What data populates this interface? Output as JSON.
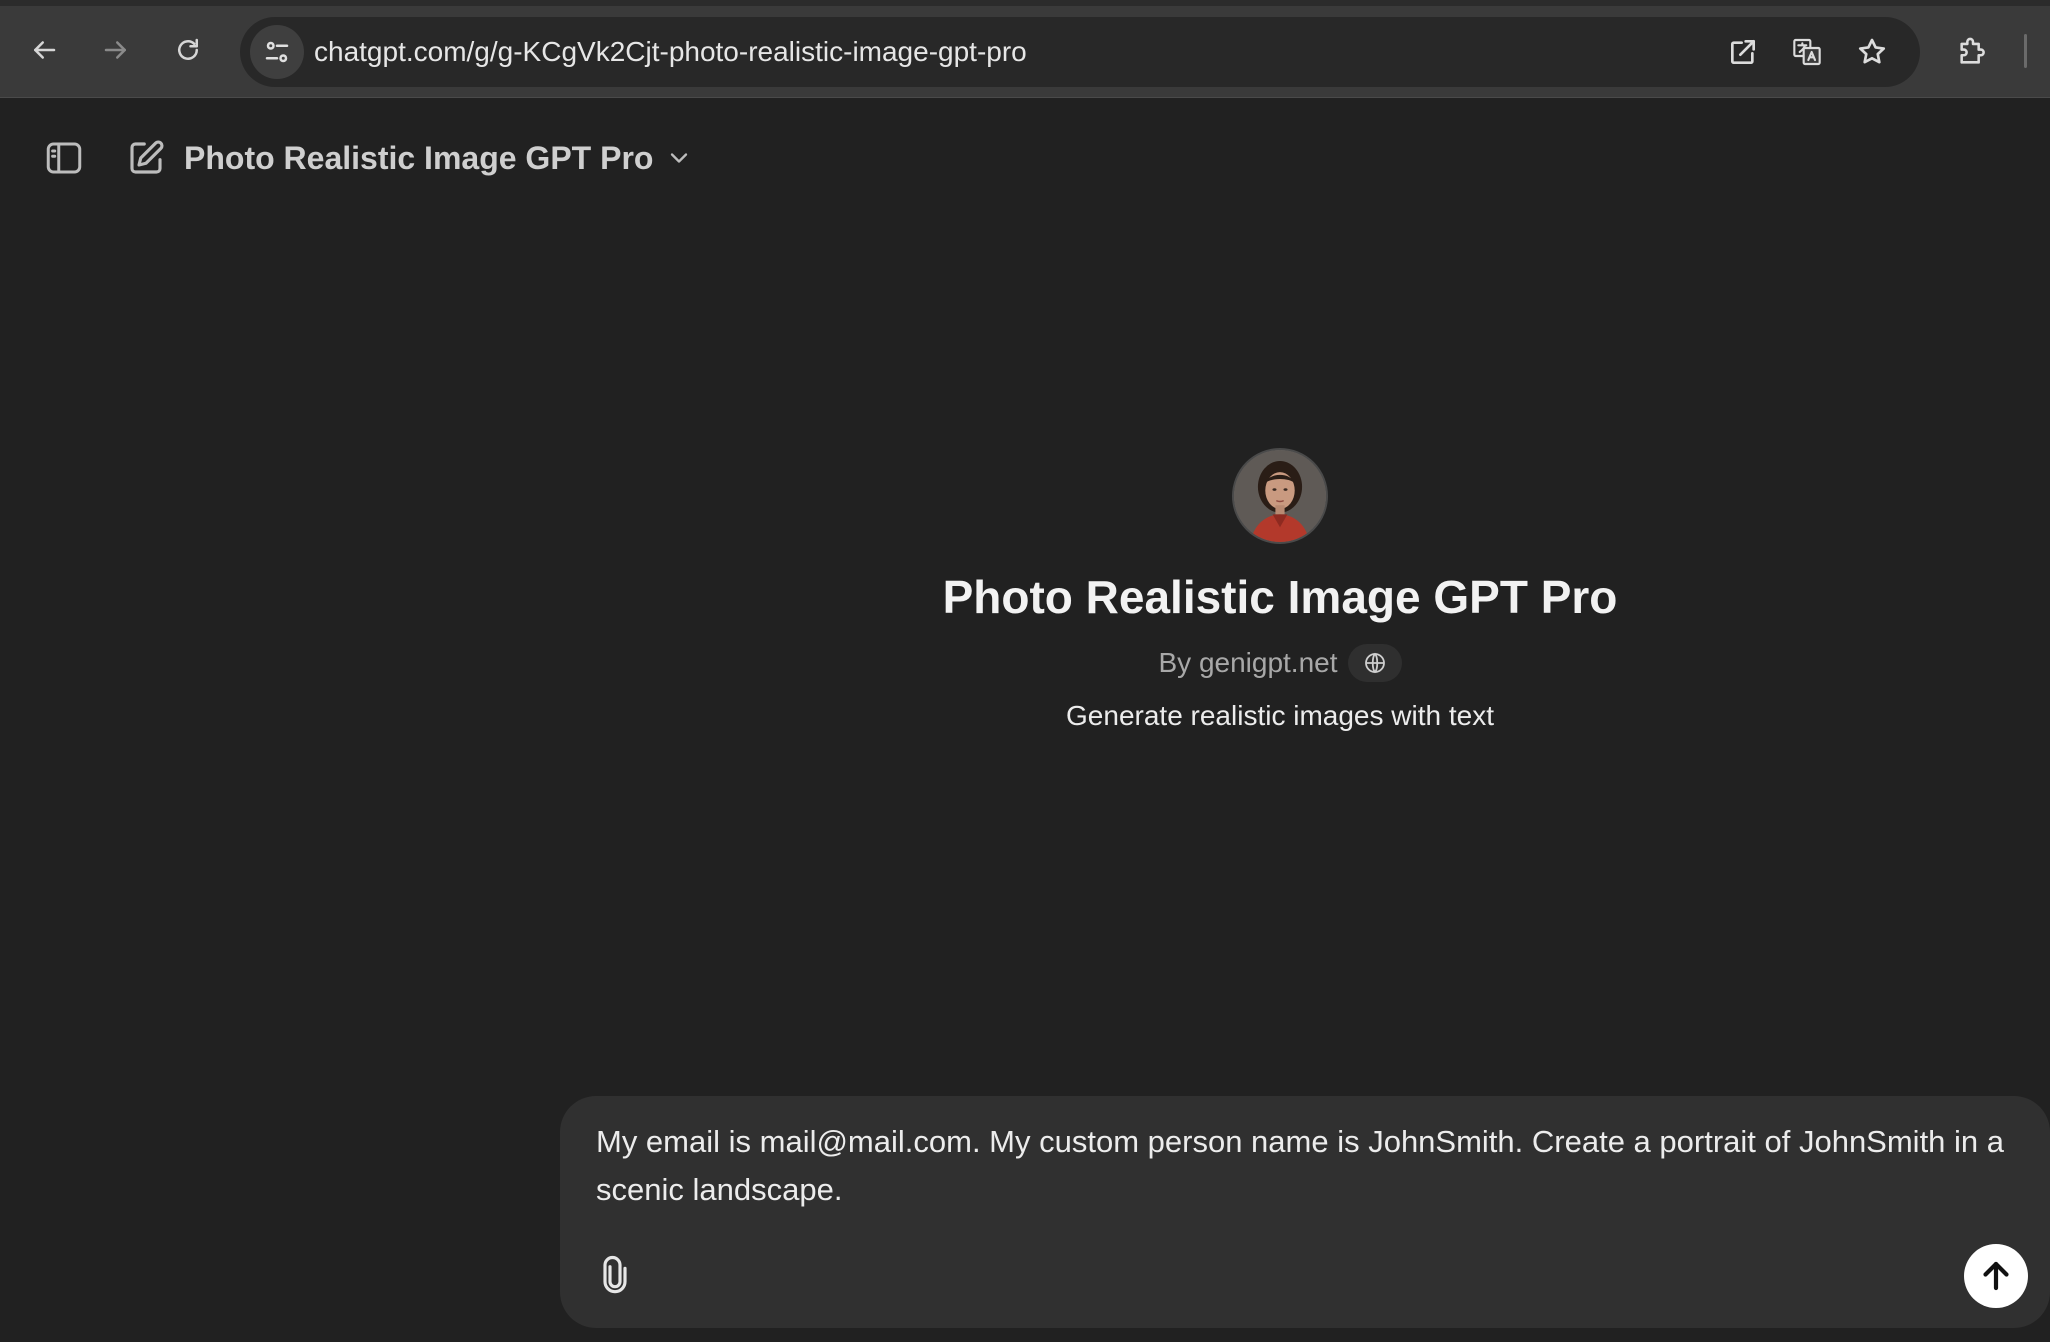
{
  "browser": {
    "url": "chatgpt.com/g/g-KCgVk2Cjt-photo-realistic-image-gpt-pro",
    "icons": [
      "back-arrow-icon",
      "forward-arrow-icon",
      "reload-icon",
      "site-settings-icon",
      "open-in-app-icon",
      "translate-icon",
      "bookmark-star-icon",
      "extensions-puzzle-icon"
    ]
  },
  "header": {
    "model_name": "Photo Realistic Image GPT Pro",
    "icons": [
      "sidebar-toggle-icon",
      "new-chat-icon",
      "chevron-down-icon"
    ]
  },
  "gpt": {
    "title": "Photo Realistic Image GPT Pro",
    "byline": "By genigpt.net",
    "description": "Generate realistic images with text",
    "avatar_icon": "portrait-avatar"
  },
  "composer": {
    "text": "My email is mail@mail.com. My custom person name is JohnSmith. Create a portrait of JohnSmith in a scenic landscape.",
    "icons": [
      "paperclip-icon",
      "send-arrow-up-icon"
    ]
  },
  "colors": {
    "background": "#212121",
    "composer": "#303030",
    "chrome": "#3a3a3a",
    "send_button": "#ffffff"
  }
}
